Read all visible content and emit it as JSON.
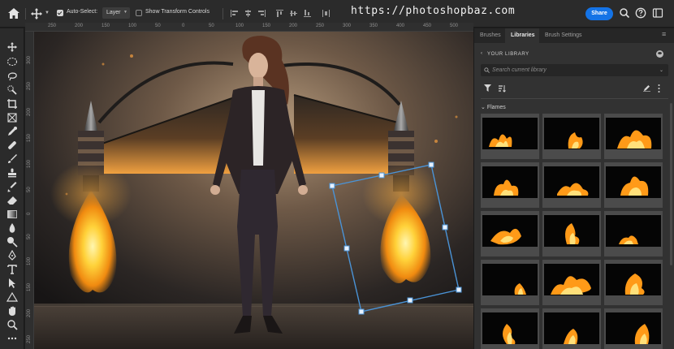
{
  "topbar": {
    "auto_select_label": "Auto-Select:",
    "auto_select_value": "Layer",
    "transform_controls_label": "Show Transform Controls",
    "watermark": "https://photoshopbaz.com",
    "share_label": "Share",
    "icons": [
      "home-icon",
      "move-icon",
      "search-icon",
      "help-icon",
      "workspace-icon"
    ]
  },
  "rulers": {
    "top": [
      "250",
      "200",
      "150",
      "100",
      "50",
      "0",
      "50",
      "100",
      "150",
      "200",
      "250",
      "300",
      "350",
      "400",
      "450",
      "500"
    ],
    "left": [
      "300",
      "250",
      "200",
      "150",
      "100",
      "50",
      "0",
      "50",
      "100",
      "150",
      "200",
      "250"
    ]
  },
  "toolbar": {
    "tools": [
      "move-tool",
      "marquee-tool",
      "lasso-tool",
      "quick-select-tool",
      "crop-tool",
      "frame-tool",
      "eyedropper-tool",
      "healing-tool",
      "brush-tool",
      "stamp-tool",
      "history-brush-tool",
      "eraser-tool",
      "gradient-tool",
      "blur-tool",
      "dodge-tool",
      "pen-tool",
      "type-tool",
      "path-select-tool",
      "shape-tool",
      "hand-tool",
      "zoom-tool",
      "more-tools"
    ]
  },
  "panel": {
    "tabs": [
      {
        "label": "Brushes",
        "active": false
      },
      {
        "label": "Libraries",
        "active": true
      },
      {
        "label": "Brush Settings",
        "active": false
      }
    ],
    "library_title": "YOUR LIBRARY",
    "search_placeholder": "Search current library",
    "group_name": "Flames",
    "thumbnails": 15
  },
  "colors": {
    "accent": "#1473e6",
    "panel": "#323232",
    "toolbar": "#2b2b2b",
    "selection": "#4a93d6",
    "flame": "#ffb21a"
  }
}
